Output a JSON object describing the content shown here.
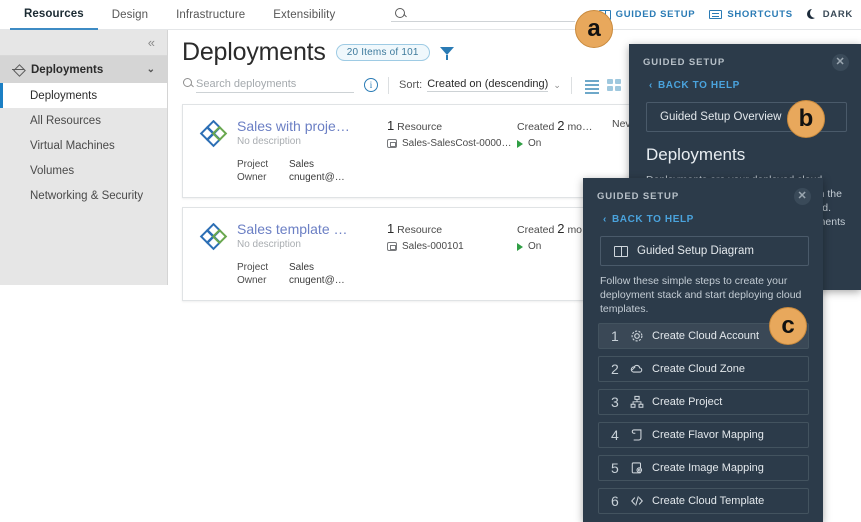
{
  "topnav": {
    "tabs": [
      {
        "label": "Resources",
        "active": true
      },
      {
        "label": "Design",
        "active": false
      },
      {
        "label": "Infrastructure",
        "active": false
      },
      {
        "label": "Extensibility",
        "active": false
      }
    ],
    "search_placeholder": "",
    "search_icon": "search-icon",
    "links": [
      {
        "label": "GUIDED SETUP",
        "icon": "book-icon"
      },
      {
        "label": "SHORTCUTS",
        "icon": "keyboard-icon"
      },
      {
        "label": "DARK",
        "icon": "moon-icon"
      }
    ]
  },
  "sidebar": {
    "collapse_icon": "«",
    "group": {
      "label": "Deployments",
      "icon": "deployments-icon",
      "chevron": "⌄"
    },
    "items": [
      {
        "label": "Deployments",
        "selected": true
      },
      {
        "label": "All Resources",
        "selected": false
      },
      {
        "label": "Virtual Machines",
        "selected": false
      },
      {
        "label": "Volumes",
        "selected": false
      },
      {
        "label": "Networking & Security",
        "selected": false
      }
    ]
  },
  "main": {
    "title": "Deployments",
    "count_badge": "20 Items of 101",
    "filter_icon": "funnel-icon",
    "toolbar": {
      "search_placeholder": "Search deployments",
      "search_value": "",
      "info_icon": "info-icon",
      "sort_label": "Sort:",
      "sort_value": "Created on (descending)",
      "sort_chevron": "⌄",
      "view_list_icon": "list-view-icon",
      "view_grid_icon": "grid-view-icon"
    },
    "cards": [
      {
        "icon": "deployment-diamond-icon",
        "name": "Sales with proje…",
        "description": "No description",
        "project_key": "Project",
        "project_value": "Sales",
        "owner_key": "Owner",
        "owner_value": "cnugent@…",
        "resource_count": "1",
        "resource_label": "Resource",
        "resource_name": "Sales-SalesCost-0000…",
        "created_prefix": "Created",
        "created_count": "2",
        "created_suffix": "mo…",
        "power_state": "On",
        "expiry": "Never exp"
      },
      {
        "icon": "deployment-diamond-icon",
        "name": "Sales template …",
        "description": "No description",
        "project_key": "Project",
        "project_value": "Sales",
        "owner_key": "Owner",
        "owner_value": "cnugent@…",
        "resource_count": "1",
        "resource_label": "Resource",
        "resource_name": "Sales-000101",
        "created_prefix": "Created",
        "created_count": "2",
        "created_suffix": "mo…",
        "power_state": "On",
        "expiry": ""
      }
    ]
  },
  "panel_overview": {
    "header": "GUIDED SETUP",
    "close_icon": "close-icon",
    "back_label": "BACK TO HELP",
    "back_icon": "chevron-left-icon",
    "button_label": "Guided Setup Overview",
    "heading": "Deployments",
    "body": "Deployments are your deployed cloud templates. They can be deployed from the catalog or using the deployment wizard. You can manage them on the deployments page."
  },
  "panel_diagram": {
    "header": "GUIDED SETUP",
    "close_icon": "close-icon",
    "back_label": "BACK TO HELP",
    "back_icon": "chevron-left-icon",
    "button_label": "Guided Setup Diagram",
    "button_icon": "diagram-icon",
    "intro": "Follow these simple steps to create your deployment stack and start deploying cloud templates.",
    "steps": [
      {
        "num": "1",
        "label": "Create Cloud Account",
        "icon": "gear-icon",
        "highlighted": true
      },
      {
        "num": "2",
        "label": "Create Cloud Zone",
        "icon": "cloud-icon",
        "highlighted": false
      },
      {
        "num": "3",
        "label": "Create Project",
        "icon": "org-chart-icon",
        "highlighted": false
      },
      {
        "num": "4",
        "label": "Create Flavor Mapping",
        "icon": "scroll-icon",
        "highlighted": false
      },
      {
        "num": "5",
        "label": "Create Image Mapping",
        "icon": "image-gear-icon",
        "highlighted": false
      },
      {
        "num": "6",
        "label": "Create Cloud Template",
        "icon": "code-icon",
        "highlighted": false
      }
    ]
  },
  "badges": [
    {
      "letter": "a"
    },
    {
      "letter": "b"
    },
    {
      "letter": "c"
    }
  ],
  "colors": {
    "accent_blue": "#2a7bb5",
    "panel_dark": "#2c3b4a",
    "badge_orange": "#e8a85c",
    "selected_bar": "#1b7fc4",
    "card_name": "#6b7fc4",
    "power_on_green": "#2f9e44"
  }
}
